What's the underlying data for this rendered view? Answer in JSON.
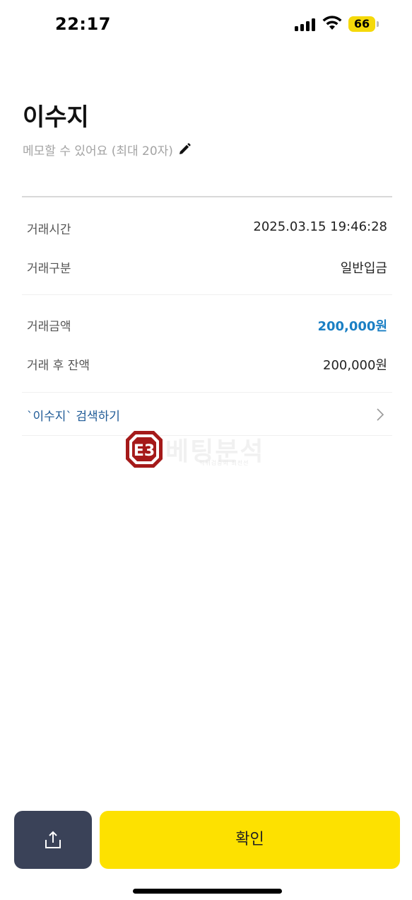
{
  "status_bar": {
    "time": "22:17",
    "battery": "66",
    "icons": [
      "signal-icon",
      "wifi-icon",
      "battery-icon"
    ]
  },
  "header": {
    "name": "이수지",
    "memo_placeholder": "메모할 수 있어요 (최대 20자)",
    "edit_icon": "pencil-icon"
  },
  "details": {
    "transaction_time_label": "거래시간",
    "transaction_time_value": "2025.03.15 19:46:28",
    "transaction_type_label": "거래구분",
    "transaction_type_value": "일반입금",
    "amount_label": "거래금액",
    "amount_value": "200,000원",
    "balance_label": "거래 후 잔액",
    "balance_value": "200,000원"
  },
  "search_link": {
    "label": "`이수지` 검색하기",
    "icon": "chevron-right-icon"
  },
  "watermark": {
    "badge": "E3",
    "text": "베팅분석",
    "subtitle": "먹튀검증의 최전선"
  },
  "buttons": {
    "share_icon": "share-icon",
    "confirm_label": "확인"
  },
  "colors": {
    "accent_yellow": "#fde100",
    "share_button": "#3a4258",
    "amount_blue": "#1a7fc4",
    "link_blue": "#1e5a96",
    "battery_yellow": "#f5d90a"
  }
}
